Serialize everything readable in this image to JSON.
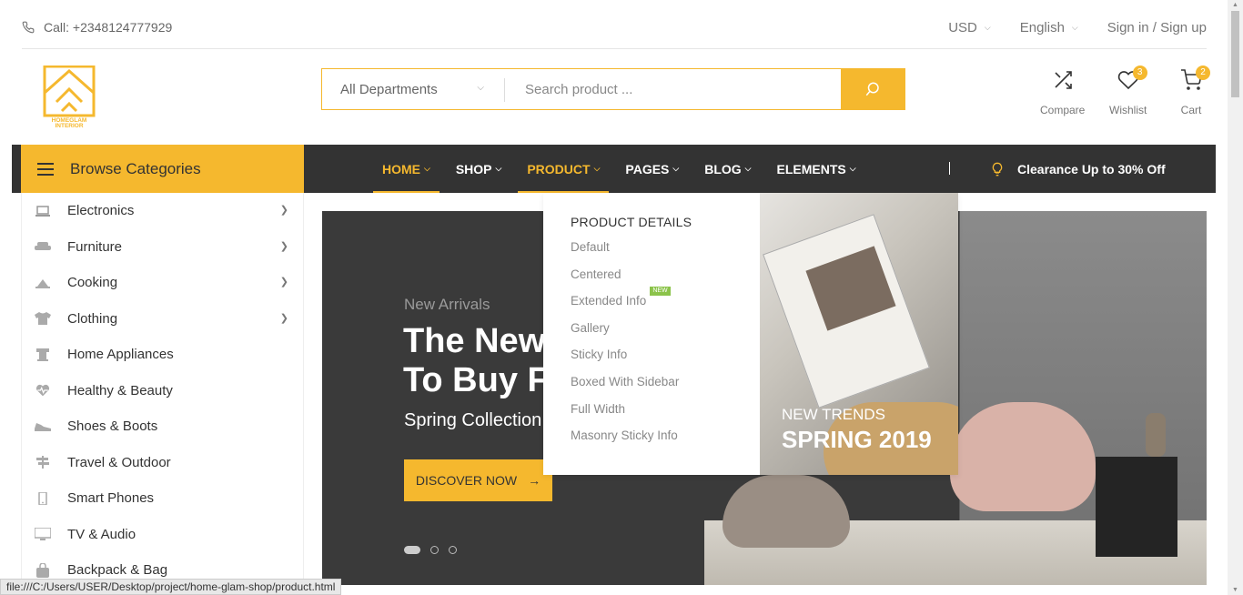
{
  "topbar": {
    "call": "Call: +2348124777929",
    "currency": "USD",
    "language": "English",
    "auth": "Sign in / Sign up"
  },
  "logo": {
    "text1": "HOMEGLAM",
    "text2": "INTERIOR"
  },
  "search": {
    "department": "All Departments",
    "placeholder": "Search product ..."
  },
  "header_icons": [
    {
      "label": "Compare",
      "icon": "shuffle-icon"
    },
    {
      "label": "Wishlist",
      "icon": "heart-icon",
      "count": "3"
    },
    {
      "label": "Cart",
      "icon": "cart-icon",
      "count": "2"
    }
  ],
  "browse": {
    "label": "Browse Categories"
  },
  "nav": {
    "items": [
      "HOME",
      "SHOP",
      "PRODUCT",
      "PAGES",
      "BLOG",
      "ELEMENTS"
    ],
    "clearance": "Clearance Up to 30% Off"
  },
  "categories": [
    {
      "label": "Electronics",
      "icon": "laptop-icon",
      "has_sub": true
    },
    {
      "label": "Furniture",
      "icon": "sofa-icon",
      "has_sub": true
    },
    {
      "label": "Cooking",
      "icon": "pot-icon",
      "has_sub": true
    },
    {
      "label": "Clothing",
      "icon": "shirt-icon",
      "has_sub": true
    },
    {
      "label": "Home Appliances",
      "icon": "appliance-icon",
      "has_sub": false
    },
    {
      "label": "Healthy & Beauty",
      "icon": "heart-pulse-icon",
      "has_sub": false
    },
    {
      "label": "Shoes & Boots",
      "icon": "shoe-icon",
      "has_sub": false
    },
    {
      "label": "Travel & Outdoor",
      "icon": "signpost-icon",
      "has_sub": false
    },
    {
      "label": "Smart Phones",
      "icon": "phone-icon",
      "has_sub": false
    },
    {
      "label": "TV & Audio",
      "icon": "tv-icon",
      "has_sub": false
    },
    {
      "label": "Backpack & Bag",
      "icon": "bag-icon",
      "has_sub": false
    }
  ],
  "hero": {
    "subtitle": "New Arrivals",
    "title_line1": "The New",
    "title_line2": "To Buy Fu",
    "collection": "Spring Collection",
    "cta": "DISCOVER NOW"
  },
  "mega": {
    "heading": "PRODUCT DETAILS",
    "links": [
      "Default",
      "Centered",
      "Extended Info",
      "Gallery",
      "Sticky Info",
      "Boxed With Sidebar",
      "Full Width",
      "Masonry Sticky Info"
    ],
    "new_badge": "NEW",
    "promo_line1": "NEW TRENDS",
    "promo_line2": "SPRING 2019"
  },
  "status_url": "file:///C:/Users/USER/Desktop/project/home-glam-shop/product.html",
  "colors": {
    "accent": "#f5b82e",
    "nav_bg": "#333333"
  }
}
